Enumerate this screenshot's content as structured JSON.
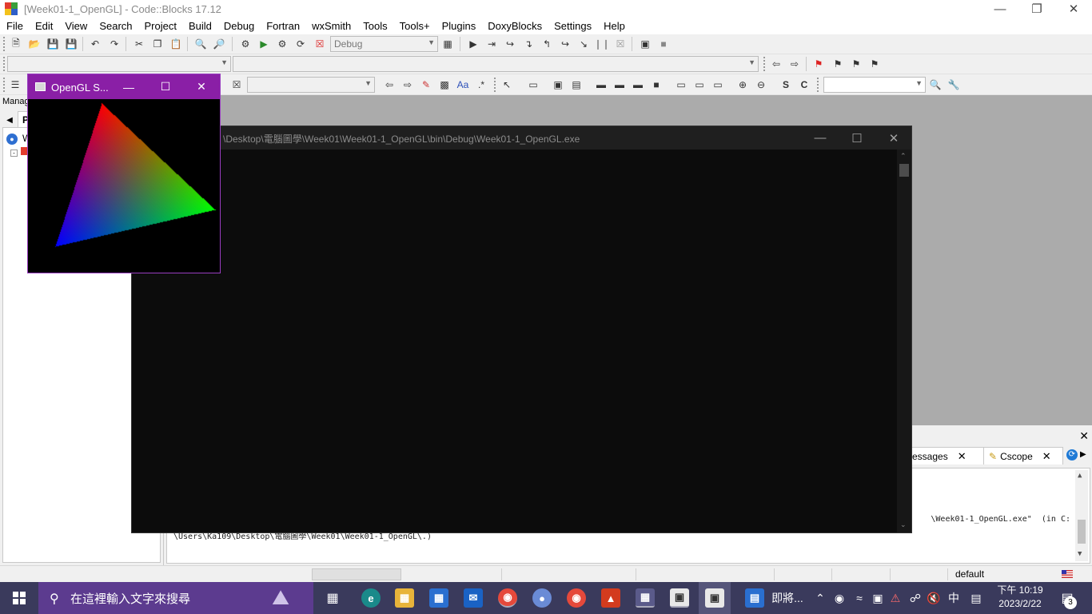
{
  "cb_window": {
    "title": "[Week01-1_OpenGL] - Code::Blocks 17.12",
    "menu": [
      "File",
      "Edit",
      "View",
      "Search",
      "Project",
      "Build",
      "Debug",
      "Fortran",
      "wxSmith",
      "Tools",
      "Tools+",
      "Plugins",
      "DoxyBlocks",
      "Settings",
      "Help"
    ],
    "build_target": "Debug",
    "management_label": "Manag",
    "tree_item_label": "W",
    "tree_tab_label": "P"
  },
  "logs": {
    "tab_messages": "essages",
    "tab_cscope": "Cscope",
    "line1": "\\Week01-1_OpenGL.exe\"  (in C:",
    "line2": "\\Users\\Ka109\\Desktop\\電腦圖學\\Week01\\Week01-1_OpenGL\\.)"
  },
  "status": {
    "encoding": "default"
  },
  "console": {
    "title": "\\Desktop\\電腦圖學\\Week01\\Week01-1_OpenGL\\bin\\Debug\\Week01-1_OpenGL.exe"
  },
  "opengl_window": {
    "title": "OpenGL S...",
    "triangle_colors": [
      "#ff0000",
      "#00ff00",
      "#0000ff"
    ]
  },
  "taskbar": {
    "search_placeholder": "在這裡輸入文字來搜尋",
    "running_app_label": "即將...",
    "ime_mode": "中",
    "clock_time": "下午 10:19",
    "clock_date": "2023/2/22",
    "notification_count": "3"
  },
  "colors": {
    "gl_titlebar": "#8a1fa6",
    "search_box": "#5c3b8f",
    "taskbar": "#3a3a5c"
  }
}
